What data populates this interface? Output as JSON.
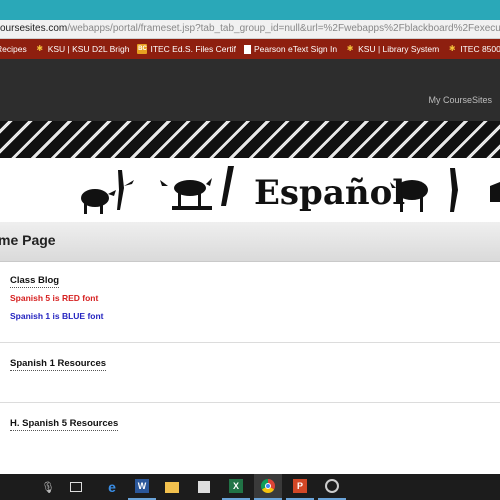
{
  "browser": {
    "url_host": "oursesites.com",
    "url_path": "/webapps/portal/frameset.jsp?tab_tab_group_id=null&url=%2Fwebapps%2Fblackboard%2Fexecute%2Flaunche",
    "bookmarks": [
      {
        "icon": "star-icon",
        "label": "Recipes"
      },
      {
        "icon": "star-icon",
        "label": "KSU | KSU D2L Brigh"
      },
      {
        "icon": "bc-icon",
        "label": "ITEC Ed.S. Files Certif"
      },
      {
        "icon": "page-icon",
        "label": "Pearson eText Sign In"
      },
      {
        "icon": "star-icon",
        "label": "KSU | Library System"
      },
      {
        "icon": "star-icon",
        "label": "ITEC 8500 Caps"
      }
    ]
  },
  "header": {
    "my_coursesites": "My CourseSites"
  },
  "banner": {
    "text": "Español"
  },
  "page": {
    "title": "me Page"
  },
  "modules": {
    "class_blog": {
      "title": "Class Blog",
      "red_note": "Spanish 5 is RED font",
      "blue_note": "Spanish 1 is BLUE font"
    },
    "spanish1": {
      "title": "Spanish 1 Resources"
    },
    "spanish5": {
      "title": "H. Spanish 5 Resources"
    }
  },
  "taskbar": {
    "items": [
      "microphone-icon",
      "task-view-icon",
      "edge-icon",
      "word-icon",
      "file-explorer-icon",
      "store-icon",
      "excel-icon",
      "chrome-icon",
      "powerpoint-icon",
      "media-icon"
    ]
  }
}
